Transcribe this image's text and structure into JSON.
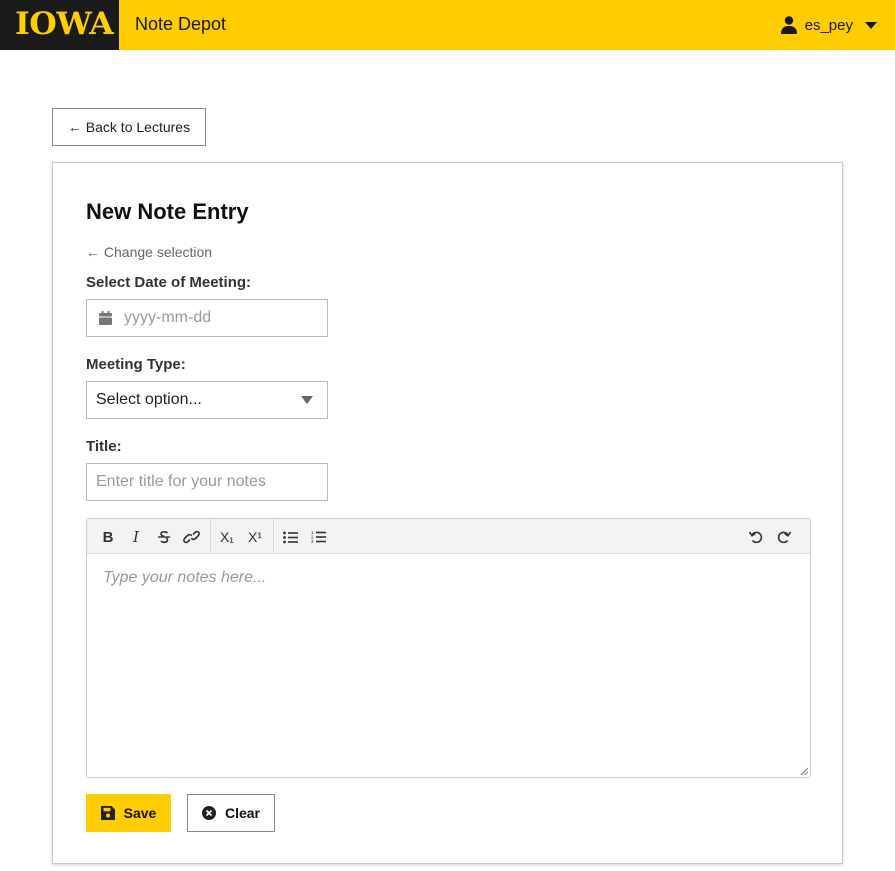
{
  "header": {
    "logo_text": "IOWA",
    "app_name": "Note Depot",
    "username": "es_pey",
    "brand_color": "#ffcd00",
    "logo_bg": "#1a1a1a",
    "user_icon": "user-icon",
    "menu_icon": "caret-down-icon"
  },
  "nav": {
    "back_label": "← Back to Lectures"
  },
  "form": {
    "title": "New Note Entry",
    "change_selection": "← Change selection",
    "date_label": "Select Date of Meeting:",
    "date_placeholder": "yyyy-mm-dd",
    "type_label": "Meeting Type:",
    "type_selected": "Select option...",
    "title_label": "Title:",
    "title_placeholder": "Enter title for your notes",
    "editor_placeholder": "Type your notes here...",
    "toolbar": {
      "bold": "B",
      "italic": "I",
      "subscript": "X₁",
      "superscript": "X¹"
    },
    "save_label": "Save",
    "clear_label": "Clear"
  }
}
